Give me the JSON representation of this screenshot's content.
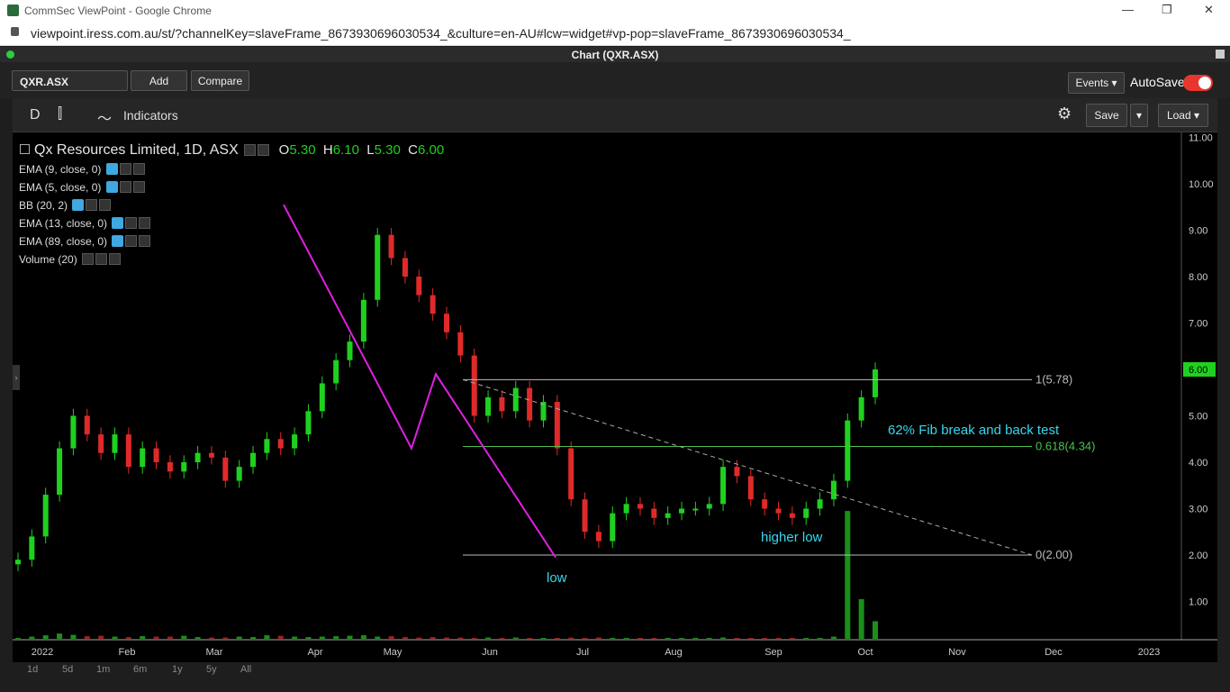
{
  "window": {
    "title": "CommSec ViewPoint - Google Chrome",
    "url": "viewpoint.iress.com.au/st/?channelKey=slaveFrame_8673930696030534_&culture=en-AU#lcw=widget#vp-pop=slaveFrame_8673930696030534_"
  },
  "panel": {
    "title": "Chart (QXR.ASX)"
  },
  "toolbar": {
    "symbol": "QXR.ASX",
    "add": "Add",
    "compare": "Compare",
    "events": "Events",
    "autosave": "AutoSave"
  },
  "chartbar": {
    "period": "D",
    "indicators": "Indicators",
    "save": "Save",
    "load": "Load"
  },
  "legend": {
    "name": "Qx Resources Limited, 1D, ASX",
    "o_label": "O",
    "o": "5.30",
    "h_label": "H",
    "h": "6.10",
    "l_label": "L",
    "l": "5.30",
    "c_label": "C",
    "c": "6.00"
  },
  "indicators": [
    "EMA (9, close, 0)",
    "EMA (5, close, 0)",
    "BB (20, 2)",
    "EMA (13, close, 0)",
    "EMA (89, close, 0)",
    "Volume (20)"
  ],
  "annotations": {
    "fib_text": "62% Fib break and back test",
    "higher_low": "higher low",
    "low": "low",
    "fib1": "1(5.78)",
    "fib618": "0.618(4.34)",
    "fib0": "0(2.00)"
  },
  "footer": {
    "ranges": [
      "1d",
      "5d",
      "1m",
      "6m",
      "1y",
      "5y",
      "All"
    ]
  },
  "colors": {
    "up": "#1fd11f",
    "down": "#e02a2a",
    "accent": "#e8362c",
    "trend": "#e020e0",
    "annot": "#36d8f0"
  },
  "chart_data": {
    "type": "candlestick",
    "y_ticks": [
      "11.00",
      "10.00",
      "9.00",
      "8.00",
      "7.00",
      "6.00",
      "5.00",
      "4.00",
      "3.00",
      "2.00",
      "1.00"
    ],
    "last_price": "6.00",
    "x_ticks": [
      "2022",
      "Feb",
      "Mar",
      "Apr",
      "May",
      "Jun",
      "Jul",
      "Aug",
      "Sep",
      "Oct",
      "Nov",
      "Dec",
      "2023"
    ],
    "ylim": [
      0,
      11
    ],
    "closes": [
      1.9,
      2.4,
      3.3,
      4.3,
      5.0,
      4.6,
      4.2,
      4.6,
      3.9,
      4.3,
      4.0,
      3.8,
      4.0,
      4.2,
      4.1,
      3.6,
      3.9,
      4.2,
      4.5,
      4.3,
      4.6,
      5.1,
      5.7,
      6.2,
      6.6,
      7.5,
      8.9,
      8.4,
      8.0,
      7.6,
      7.2,
      6.8,
      6.3,
      5.0,
      5.4,
      5.1,
      5.6,
      4.9,
      5.3,
      4.3,
      3.2,
      2.5,
      2.3,
      2.9,
      3.1,
      3.0,
      2.8,
      2.9,
      3.0,
      3.0,
      3.1,
      3.9,
      3.7,
      3.2,
      3.0,
      2.9,
      2.8,
      3.0,
      3.2,
      3.6,
      4.9,
      5.4,
      6.0
    ],
    "volumes": [
      0.02,
      0.05,
      0.08,
      0.12,
      0.09,
      0.06,
      0.07,
      0.05,
      0.04,
      0.06,
      0.05,
      0.05,
      0.07,
      0.04,
      0.03,
      0.03,
      0.05,
      0.04,
      0.08,
      0.07,
      0.05,
      0.04,
      0.05,
      0.06,
      0.07,
      0.08,
      0.05,
      0.06,
      0.04,
      0.03,
      0.04,
      0.03,
      0.03,
      0.02,
      0.03,
      0.02,
      0.03,
      0.02,
      0.02,
      0.02,
      0.03,
      0.02,
      0.03,
      0.02,
      0.02,
      0.02,
      0.02,
      0.02,
      0.02,
      0.02,
      0.02,
      0.03,
      0.02,
      0.02,
      0.02,
      0.02,
      0.02,
      0.02,
      0.02,
      0.05,
      2.9,
      0.9,
      0.4
    ]
  }
}
